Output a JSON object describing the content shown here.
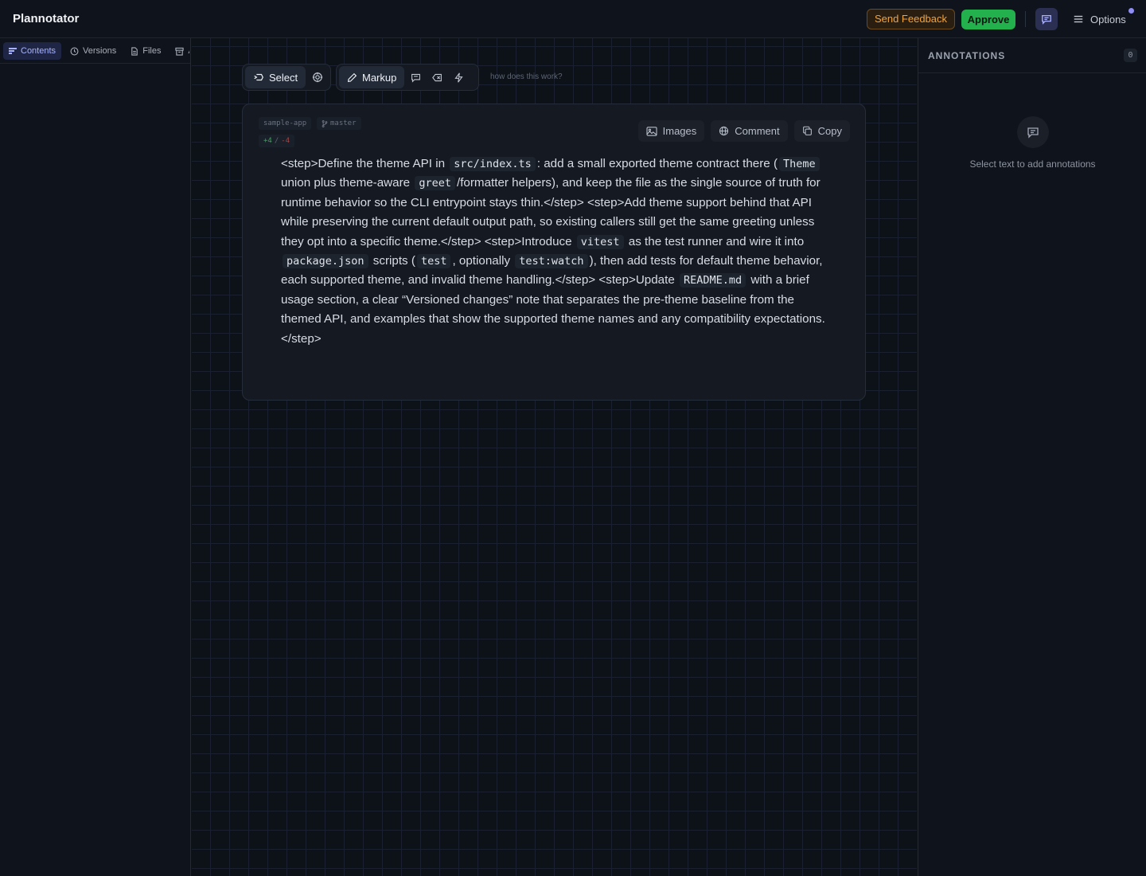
{
  "header": {
    "app_title": "Plannotator",
    "send_feedback": "Send Feedback",
    "approve": "Approve",
    "options": "Options"
  },
  "sidebar": {
    "tabs": [
      {
        "label": "Contents",
        "icon": "contents-icon",
        "active": true
      },
      {
        "label": "Versions",
        "icon": "clock-icon",
        "active": false
      },
      {
        "label": "Files",
        "icon": "file-icon",
        "active": false
      },
      {
        "label": "A",
        "icon": "archive-icon",
        "active": false
      }
    ]
  },
  "toolbar": {
    "select_label": "Select",
    "markup_label": "Markup",
    "hint": "how does this work?"
  },
  "document": {
    "repo": "sample-app",
    "branch": "master",
    "additions": "+4",
    "separator": "/",
    "deletions": "-4",
    "actions": {
      "images": "Images",
      "comment": "Comment",
      "copy": "Copy"
    },
    "segments": [
      {
        "t": "text",
        "v": "<step>Define the theme API in "
      },
      {
        "t": "code",
        "v": "src/index.ts"
      },
      {
        "t": "text",
        "v": ": add a small exported theme contract there ("
      },
      {
        "t": "code",
        "v": "Theme"
      },
      {
        "t": "text",
        "v": " union plus theme-aware "
      },
      {
        "t": "code",
        "v": "greet"
      },
      {
        "t": "text",
        "v": "/formatter helpers), and keep the file as the single source of truth for runtime behavior so the CLI entrypoint stays thin.</step> <step>Add theme support behind that API while preserving the current default output path, so existing callers still get the same greeting unless they opt into a specific theme.</step> <step>Introduce "
      },
      {
        "t": "code",
        "v": "vitest"
      },
      {
        "t": "text",
        "v": " as the test runner and wire it into "
      },
      {
        "t": "code",
        "v": "package.json"
      },
      {
        "t": "text",
        "v": " scripts ("
      },
      {
        "t": "code",
        "v": "test"
      },
      {
        "t": "text",
        "v": ", optionally "
      },
      {
        "t": "code",
        "v": "test:watch"
      },
      {
        "t": "text",
        "v": "), then add tests for default theme behavior, each supported theme, and invalid theme handling.</step> <step>Update "
      },
      {
        "t": "code",
        "v": "README.md"
      },
      {
        "t": "text",
        "v": " with a brief usage section, a clear “Versioned changes” note that separates the pre-theme baseline from the themed API, and examples that show the supported theme names and any compatibility expectations.</step>"
      }
    ]
  },
  "annotations": {
    "title": "ANNOTATIONS",
    "count": "0",
    "empty_text": "Select text to add annotations"
  },
  "colors": {
    "accent": "#8f8ff5",
    "approve": "#23b14d",
    "feedback": "#f2a43c",
    "background": "#0d1118"
  }
}
